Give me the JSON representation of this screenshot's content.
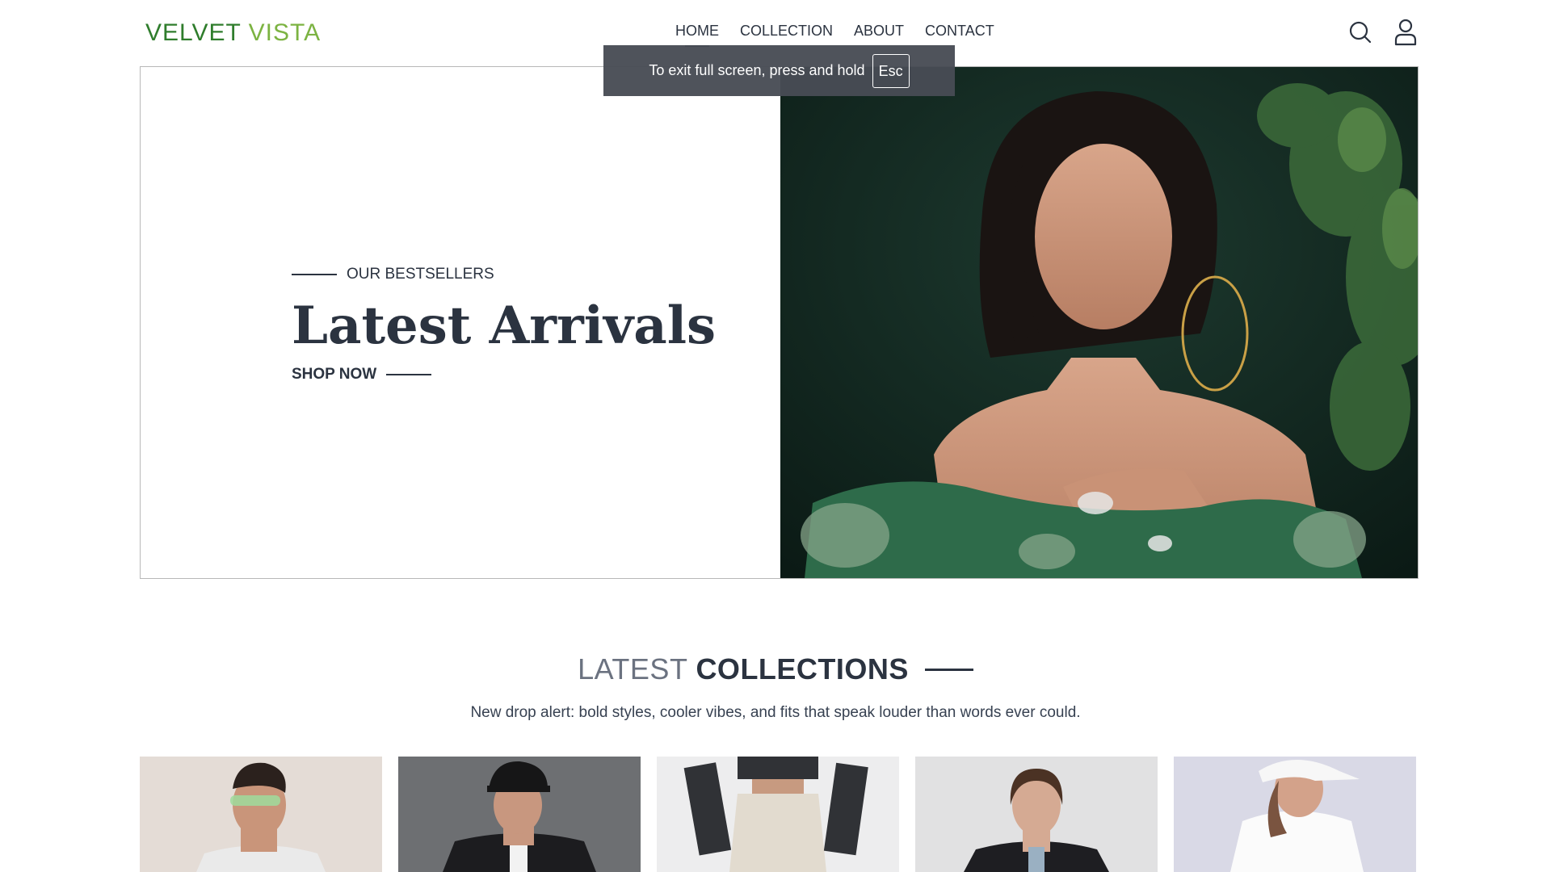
{
  "header": {
    "logo_word1": "VELVET",
    "logo_word2": "VISTA",
    "nav": [
      "HOME",
      "COLLECTION",
      "ABOUT",
      "CONTACT"
    ],
    "active_nav": "HOME",
    "icons": [
      "search-icon",
      "user-icon"
    ]
  },
  "fullscreen_notice": {
    "text": "To exit full screen, press and hold",
    "key": "Esc"
  },
  "hero": {
    "eyebrow": "OUR BESTSELLERS",
    "title": "Latest Arrivals",
    "cta": "SHOP NOW"
  },
  "collections": {
    "title_light": "LATEST",
    "title_bold": "COLLECTIONS",
    "subtitle": "New drop alert: bold styles, cooler vibes, and fits that speak louder than words ever could."
  },
  "colors": {
    "logo_dark_green": "#2f7d2c",
    "logo_light_green": "#7cb342",
    "text_dark": "#2b3340",
    "toast_bg": "#484c54"
  }
}
